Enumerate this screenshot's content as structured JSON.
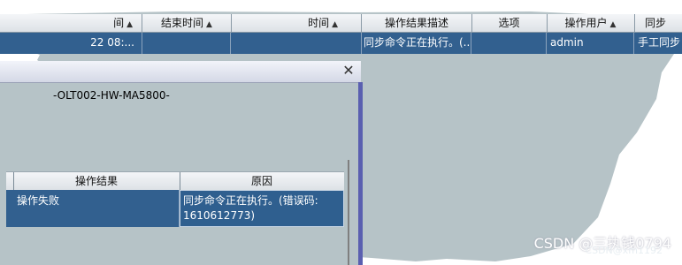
{
  "main_table": {
    "columns": [
      {
        "label": "间",
        "arrow": "▲"
      },
      {
        "label": "结束时间",
        "arrow": "▲"
      },
      {
        "label": "时间",
        "arrow": "▲"
      },
      {
        "label": "操作结果描述",
        "arrow": ""
      },
      {
        "label": "选项",
        "arrow": ""
      },
      {
        "label": "操作用户",
        "arrow": "▲"
      },
      {
        "label": "同步",
        "arrow": ""
      }
    ],
    "row": {
      "start_time": "22 08:...",
      "end_time": "",
      "time": "",
      "description": "同步命令正在执行。(...",
      "option": "",
      "user": "admin",
      "sync": "手工同步"
    }
  },
  "dialog": {
    "close_glyph": "✕",
    "device_name": "-OLT002-HW-MA5800-",
    "results_table": {
      "columns": [
        "操作结果",
        "原因"
      ],
      "row": {
        "result": "操作失败",
        "reason_line1": "同步命令正在执行。(错误码:",
        "reason_line2": "1610612773)"
      }
    }
  },
  "watermark": "CSDN @三执钱0794",
  "watermark_small": "CSDN@xm1192",
  "colors": {
    "selection": "#32608f",
    "background": "#b6c3c7",
    "dialog_border": "#5a5fb0"
  }
}
